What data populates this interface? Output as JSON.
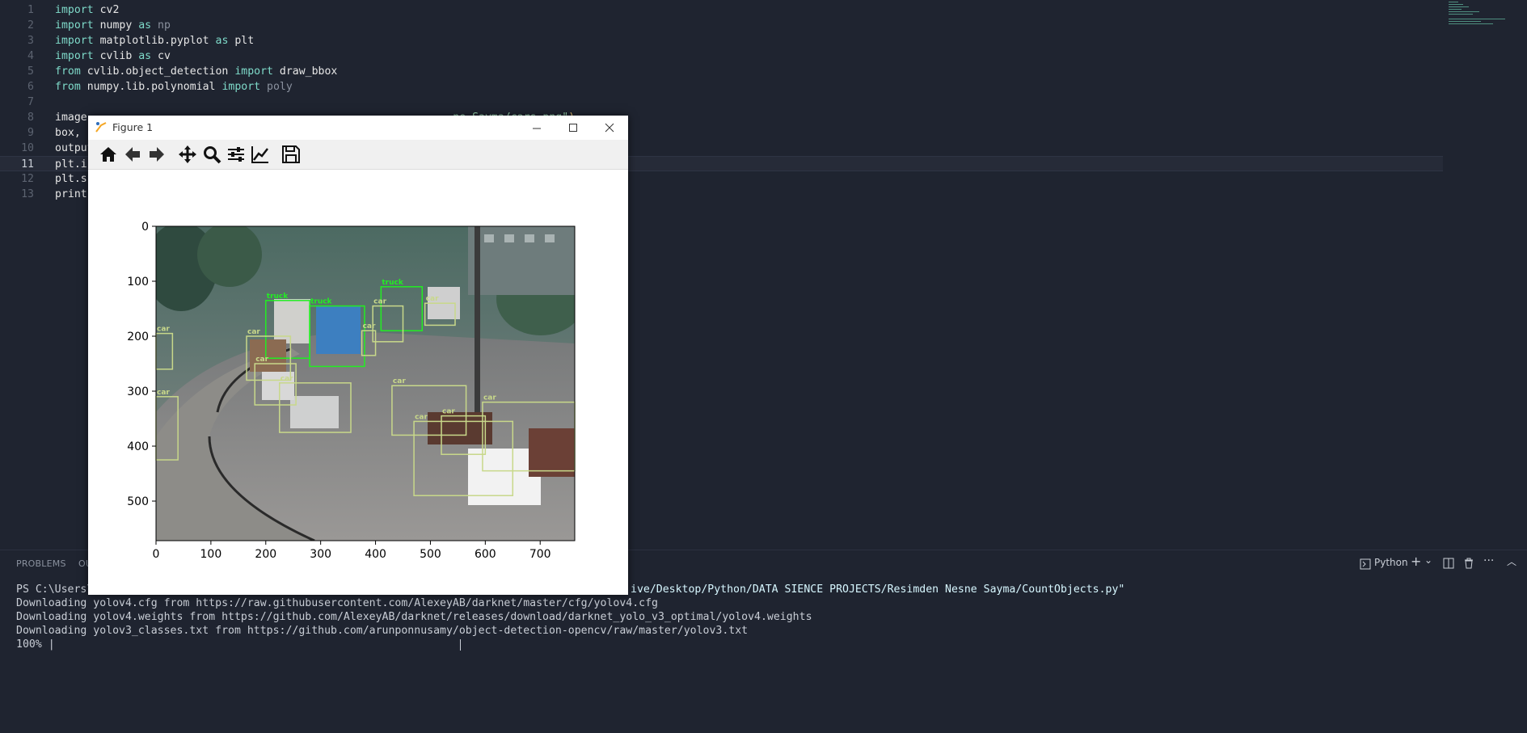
{
  "editor": {
    "lines": [
      {
        "n": "1",
        "parts": [
          {
            "t": "import",
            "c": "kw"
          },
          {
            "t": " cv2",
            "c": "mod"
          }
        ]
      },
      {
        "n": "2",
        "parts": [
          {
            "t": "import",
            "c": "kw"
          },
          {
            "t": " numpy ",
            "c": "mod"
          },
          {
            "t": "as",
            "c": "kw"
          },
          {
            "t": " np",
            "c": "dim"
          }
        ]
      },
      {
        "n": "3",
        "parts": [
          {
            "t": "import",
            "c": "kw"
          },
          {
            "t": " matplotlib.pyplot ",
            "c": "mod"
          },
          {
            "t": "as",
            "c": "kw"
          },
          {
            "t": " plt",
            "c": "mod"
          }
        ]
      },
      {
        "n": "4",
        "parts": [
          {
            "t": "import",
            "c": "kw"
          },
          {
            "t": " cvlib ",
            "c": "mod"
          },
          {
            "t": "as",
            "c": "kw"
          },
          {
            "t": " cv",
            "c": "mod"
          }
        ]
      },
      {
        "n": "5",
        "parts": [
          {
            "t": "from",
            "c": "kw"
          },
          {
            "t": " cvlib.object_detection ",
            "c": "mod"
          },
          {
            "t": "import",
            "c": "kw"
          },
          {
            "t": " draw_bbox",
            "c": "mod"
          }
        ]
      },
      {
        "n": "6",
        "parts": [
          {
            "t": "from",
            "c": "kw"
          },
          {
            "t": " numpy.lib.polynomial ",
            "c": "mod"
          },
          {
            "t": "import",
            "c": "kw"
          },
          {
            "t": " poly",
            "c": "dim"
          }
        ]
      },
      {
        "n": "7",
        "parts": []
      },
      {
        "n": "8",
        "parts": [
          {
            "t": "image",
            "c": "mod"
          },
          {
            "t": "                                                         ",
            "c": "mod"
          },
          {
            "t": "ne Sayma/cars.png\"",
            "c": "str"
          },
          {
            "t": ")",
            "c": "paren"
          }
        ]
      },
      {
        "n": "9",
        "parts": [
          {
            "t": "box,",
            "c": "mod"
          }
        ]
      },
      {
        "n": "10",
        "parts": [
          {
            "t": "output",
            "c": "mod"
          }
        ]
      },
      {
        "n": "11",
        "parts": [
          {
            "t": "plt.i",
            "c": "mod"
          }
        ]
      },
      {
        "n": "12",
        "parts": [
          {
            "t": "plt.sh",
            "c": "mod"
          }
        ]
      },
      {
        "n": "13",
        "parts": [
          {
            "t": "print",
            "c": "mod"
          }
        ]
      }
    ],
    "active_line": "11"
  },
  "panel": {
    "tabs": [
      "PROBLEMS",
      "OU"
    ],
    "terminal_profile": "Python",
    "terminal": {
      "line1_prefix": "PS C:\\Users\\e",
      "line1_suffix": "ive/Desktop/Python/DATA SIENCE PROJECTS/Resimden Nesne Sayma/CountObjects.py\"",
      "line2": "Downloading yolov4.cfg from https://raw.githubusercontent.com/AlexeyAB/darknet/master/cfg/yolov4.cfg",
      "line3": "Downloading yolov4.weights from https://github.com/AlexeyAB/darknet/releases/download/darknet_yolo_v3_optimal/yolov4.weights",
      "line4": "Downloading yolov3_classes.txt from https://github.com/arunponnusamy/object-detection-opencv/raw/master/yolov3.txt",
      "line5": "100% |"
    }
  },
  "figure": {
    "title": "Figure 1",
    "toolbar_icons": [
      "home-icon",
      "back-arrow-icon",
      "forward-arrow-icon",
      "pan-move-icon",
      "zoom-magnifier-icon",
      "configure-subplots-icon",
      "edit-axis-icon",
      "save-floppy-icon"
    ],
    "window_buttons": [
      "minimize-icon",
      "maximize-icon",
      "close-icon"
    ],
    "detections": [
      {
        "label": "truck",
        "color": "#22ee22"
      },
      {
        "label": "truck",
        "color": "#22ee22"
      },
      {
        "label": "truck",
        "color": "#22ee22"
      },
      {
        "label": "car",
        "color": "#c8d88a"
      },
      {
        "label": "car",
        "color": "#c8d88a"
      },
      {
        "label": "car",
        "color": "#c8d88a"
      },
      {
        "label": "car",
        "color": "#c8d88a"
      },
      {
        "label": "car",
        "color": "#c8d88a"
      },
      {
        "label": "car",
        "color": "#c8d88a"
      },
      {
        "label": "car",
        "color": "#c8d88a"
      },
      {
        "label": "car",
        "color": "#c8d88a"
      },
      {
        "label": "car",
        "color": "#c8d88a"
      },
      {
        "label": "car",
        "color": "#c8d88a"
      },
      {
        "label": "car",
        "color": "#c8d88a"
      },
      {
        "label": "car",
        "color": "#c8d88a"
      }
    ]
  },
  "chart_data": {
    "type": "image",
    "xticks": [
      0,
      100,
      200,
      300,
      400,
      500,
      600,
      700
    ],
    "yticks": [
      0,
      100,
      200,
      300,
      400,
      500
    ],
    "xlim": [
      0,
      763
    ],
    "ylim": [
      572,
      0
    ],
    "title": "",
    "xlabel": "",
    "ylabel": "",
    "boxes": [
      {
        "label": "truck",
        "x0": 200,
        "y0": 135,
        "x1": 280,
        "y1": 240
      },
      {
        "label": "truck",
        "x0": 280,
        "y0": 145,
        "x1": 380,
        "y1": 255
      },
      {
        "label": "truck",
        "x0": 410,
        "y0": 110,
        "x1": 485,
        "y1": 190
      },
      {
        "label": "car",
        "x0": 490,
        "y0": 140,
        "x1": 545,
        "y1": 180
      },
      {
        "label": "car",
        "x0": 395,
        "y0": 145,
        "x1": 450,
        "y1": 210
      },
      {
        "label": "car",
        "x0": 375,
        "y0": 190,
        "x1": 400,
        "y1": 235
      },
      {
        "label": "car",
        "x0": 0,
        "y0": 195,
        "x1": 30,
        "y1": 260
      },
      {
        "label": "car",
        "x0": 165,
        "y0": 200,
        "x1": 245,
        "y1": 280
      },
      {
        "label": "car",
        "x0": 180,
        "y0": 250,
        "x1": 255,
        "y1": 325
      },
      {
        "label": "car",
        "x0": 225,
        "y0": 285,
        "x1": 355,
        "y1": 375
      },
      {
        "label": "car",
        "x0": 0,
        "y0": 310,
        "x1": 40,
        "y1": 425
      },
      {
        "label": "car",
        "x0": 430,
        "y0": 290,
        "x1": 565,
        "y1": 380
      },
      {
        "label": "car",
        "x0": 595,
        "y0": 320,
        "x1": 763,
        "y1": 445
      },
      {
        "label": "car",
        "x0": 470,
        "y0": 355,
        "x1": 650,
        "y1": 490
      },
      {
        "label": "car",
        "x0": 520,
        "y0": 345,
        "x1": 600,
        "y1": 415
      }
    ]
  }
}
